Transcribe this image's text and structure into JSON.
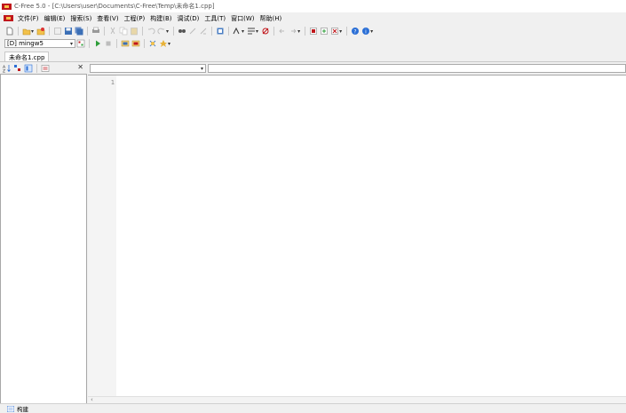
{
  "window": {
    "title": "C-Free 5.0 - [C:\\Users\\user\\Documents\\C-Free\\Temp\\未命名1.cpp]"
  },
  "menu": [
    {
      "label": "文件(F)"
    },
    {
      "label": "编辑(E)"
    },
    {
      "label": "搜索(S)"
    },
    {
      "label": "查看(V)"
    },
    {
      "label": "工程(P)"
    },
    {
      "label": "构建(B)"
    },
    {
      "label": "调试(D)"
    },
    {
      "label": "工具(T)"
    },
    {
      "label": "窗口(W)"
    },
    {
      "label": "帮助(H)"
    }
  ],
  "compiler": {
    "selected": "[D] mingw5"
  },
  "tabs": [
    {
      "label": "未命名1.cpp",
      "active": true
    }
  ],
  "left_panel": {
    "close_glyph": "✕"
  },
  "editor": {
    "line_numbers": [
      "1"
    ],
    "scope_combo_value": "",
    "function_combo_value": ""
  },
  "status": {
    "build_label": "构建"
  },
  "colors": {
    "app_red": "#c0161b",
    "run_green": "#2e9e3a",
    "help_blue": "#2b6fd6"
  },
  "icons": {
    "app": "cfree-app-icon",
    "new": "new-file-icon",
    "open": "open-folder-icon",
    "save": "save-icon",
    "run": "run-icon",
    "stop": "stop-icon",
    "help": "help-icon"
  }
}
